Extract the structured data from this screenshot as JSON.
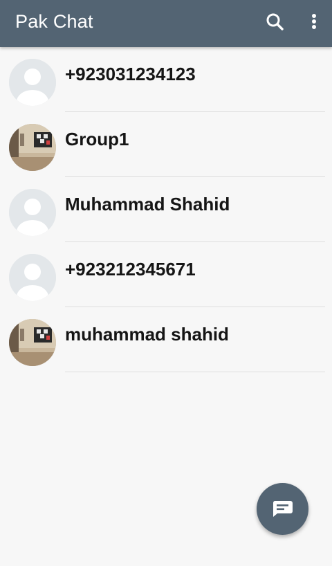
{
  "app_bar": {
    "title": "Pak Chat",
    "search_icon": "search-icon",
    "menu_icon": "more-vert-icon",
    "background": "#536473"
  },
  "chats": [
    {
      "name": "+923031234123",
      "avatar": "default-avatar-icon"
    },
    {
      "name": "Group1",
      "avatar": "photo-avatar"
    },
    {
      "name": "Muhammad Shahid",
      "avatar": "default-avatar-icon"
    },
    {
      "name": "+923212345671",
      "avatar": "default-avatar-icon"
    },
    {
      "name": "muhammad shahid",
      "avatar": "photo-avatar"
    }
  ],
  "fab": {
    "icon": "new-message-icon",
    "background": "#536473"
  }
}
